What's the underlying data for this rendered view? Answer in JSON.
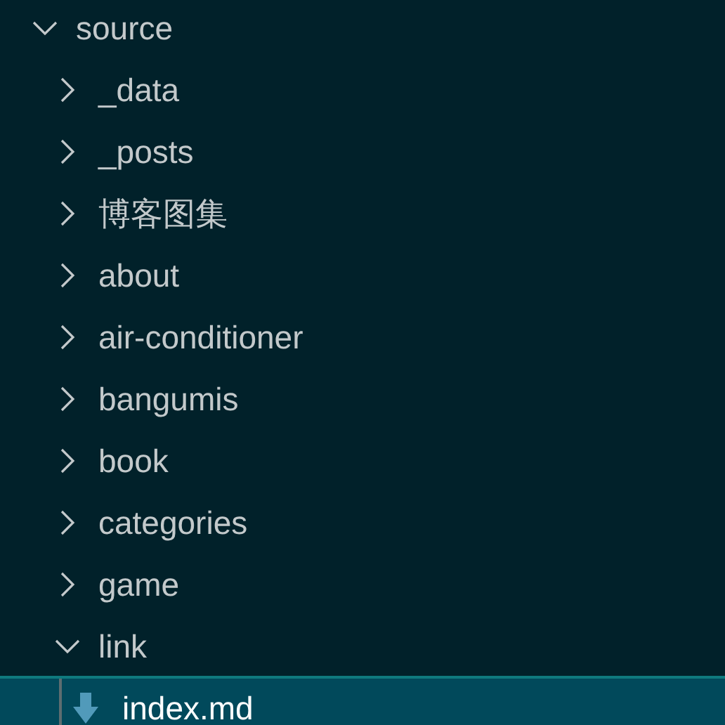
{
  "tree": [
    {
      "label": "source",
      "kind": "folder",
      "expanded": true,
      "selected": false,
      "children": [
        {
          "label": "_data",
          "kind": "folder",
          "expanded": false,
          "selected": false
        },
        {
          "label": "_posts",
          "kind": "folder",
          "expanded": false,
          "selected": false
        },
        {
          "label": "博客图集",
          "kind": "folder",
          "expanded": false,
          "selected": false
        },
        {
          "label": "about",
          "kind": "folder",
          "expanded": false,
          "selected": false
        },
        {
          "label": "air-conditioner",
          "kind": "folder",
          "expanded": false,
          "selected": false
        },
        {
          "label": "bangumis",
          "kind": "folder",
          "expanded": false,
          "selected": false
        },
        {
          "label": "book",
          "kind": "folder",
          "expanded": false,
          "selected": false
        },
        {
          "label": "categories",
          "kind": "folder",
          "expanded": false,
          "selected": false
        },
        {
          "label": "game",
          "kind": "folder",
          "expanded": false,
          "selected": false
        },
        {
          "label": "link",
          "kind": "folder",
          "expanded": true,
          "selected": false,
          "children": [
            {
              "label": "index.md",
              "kind": "file",
              "selected": true
            }
          ]
        }
      ]
    }
  ]
}
